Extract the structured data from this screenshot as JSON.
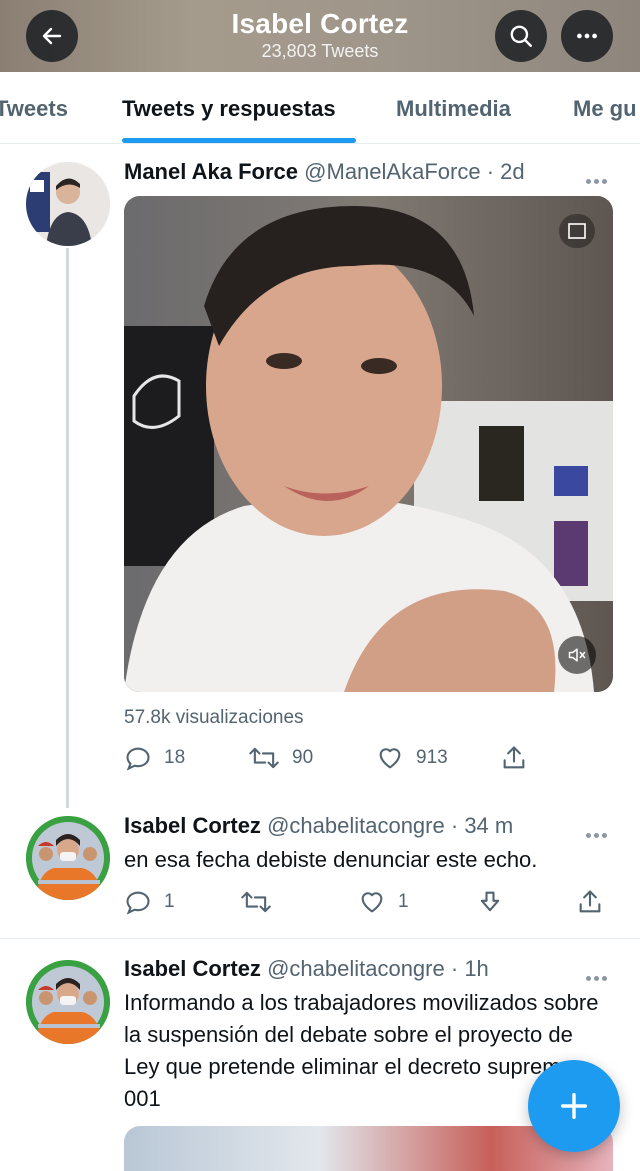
{
  "header": {
    "title": "Isabel Cortez",
    "subtitle": "23,803 Tweets"
  },
  "tabs": [
    {
      "label": "Tweets"
    },
    {
      "label": "Tweets y respuestas"
    },
    {
      "label": "Multimedia"
    },
    {
      "label": "Me gu"
    }
  ],
  "tweets": [
    {
      "name": "Manel Aka Force",
      "handle": "@ManelAkaForce",
      "sep": "·",
      "time": "2d",
      "views": "57.8k visualizaciones",
      "replies": "18",
      "retweets": "90",
      "likes": "913"
    },
    {
      "name": "Isabel Cortez",
      "handle": "@chabelitacongre",
      "sep": "·",
      "time": "34 m",
      "text": "en esa fecha debiste denunciar este echo.",
      "replies": "1",
      "likes": "1"
    },
    {
      "name": "Isabel Cortez",
      "handle": "@chabelitacongre",
      "sep": "·",
      "time": "1h",
      "text": "Informando a los trabajadores movilizados sobre la suspensión del debate sobre el proyecto de Ley que pretende eliminar el decreto supremo 001"
    }
  ],
  "colors": {
    "accent": "#1d9bf0",
    "muted": "#536471",
    "text": "#0f1419"
  }
}
